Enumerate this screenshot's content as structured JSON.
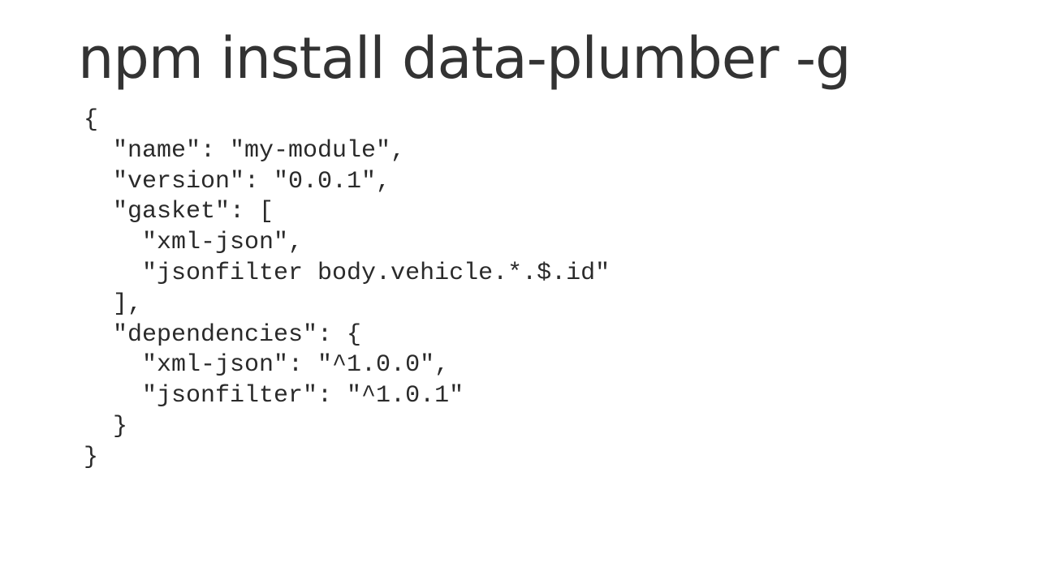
{
  "slide": {
    "title": "npm install data-plumber -g",
    "code_lines": [
      "{",
      "  \"name\": \"my-module\",",
      "  \"version\": \"0.0.1\",",
      "  \"gasket\": [",
      "    \"xml-json\",",
      "    \"jsonfilter body.vehicle.*.$.id\"",
      "  ],",
      "  \"dependencies\": {",
      "    \"xml-json\": \"^1.0.0\",",
      "    \"jsonfilter\": \"^1.0.1\"",
      "  }",
      "}"
    ]
  }
}
